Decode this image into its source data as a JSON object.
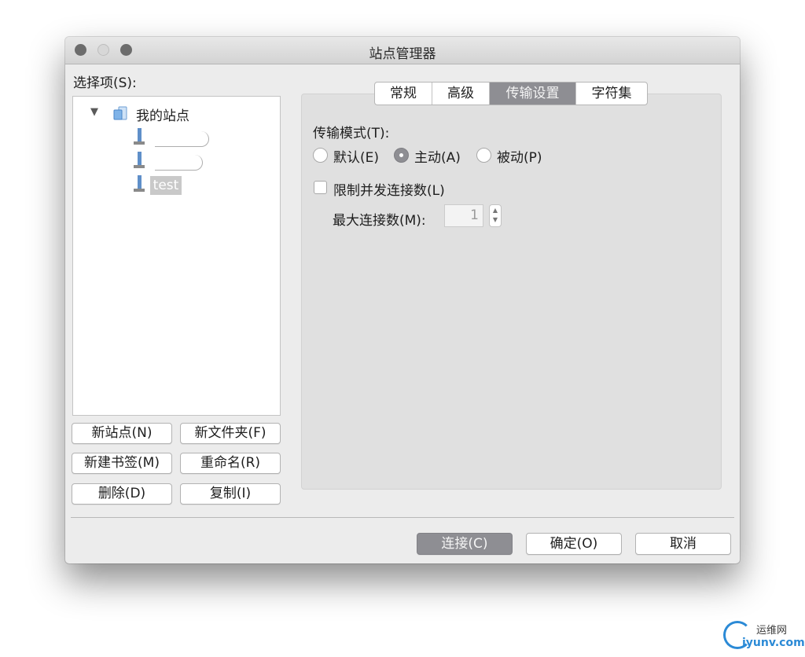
{
  "window": {
    "title": "站点管理器"
  },
  "site_tree": {
    "label": "选择项(S):",
    "root": "我的站点",
    "sites": [
      "",
      "",
      "test"
    ],
    "selected": "test"
  },
  "left_buttons": {
    "new_site": "新站点(N)",
    "new_folder": "新文件夹(F)",
    "new_bookmark": "新建书签(M)",
    "rename": "重命名(R)",
    "delete": "删除(D)",
    "duplicate": "复制(I)"
  },
  "tabs": [
    {
      "label": "常规",
      "active": false
    },
    {
      "label": "高级",
      "active": false
    },
    {
      "label": "传输设置",
      "active": true
    },
    {
      "label": "字符集",
      "active": false
    }
  ],
  "transfer": {
    "mode_label": "传输模式(T):",
    "modes": [
      {
        "label": "默认(E)",
        "selected": false
      },
      {
        "label": "主动(A)",
        "selected": true
      },
      {
        "label": "被动(P)",
        "selected": false
      }
    ],
    "limit_label": "限制并发连接数(L)",
    "limit_checked": false,
    "max_label": "最大连接数(M):",
    "max_value": "1"
  },
  "footer": {
    "connect": "连接(C)",
    "ok": "确定(O)",
    "cancel": "取消"
  },
  "watermark": {
    "top": "运维网",
    "bottom": "iyunv.com"
  },
  "colors": {
    "accent": "#8e8e93",
    "window_bg": "#ececec",
    "panel_bg": "#e0e0e0",
    "watermark_blue": "#2b8ad6"
  },
  "icons": [
    "disclosure-triangle-icon",
    "folder-icon",
    "server-icon",
    "stepper-icon"
  ]
}
